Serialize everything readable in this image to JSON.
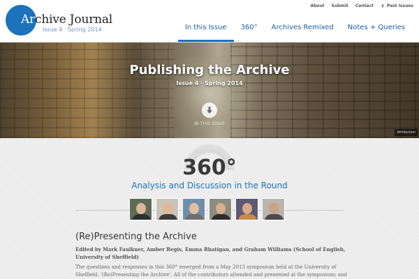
{
  "site": {
    "title_prefix": "Ar",
    "title_rest": "chive Journal",
    "issue": "Issue 4 · Spring 2014",
    "brand_color": "#1a73bb"
  },
  "util_nav": {
    "about": "About",
    "submit": "Submit",
    "contact": "Contact",
    "past_issues": "Past Issues",
    "past_icon": "pin-icon"
  },
  "main_nav": [
    {
      "label": "In this Issue",
      "active": true
    },
    {
      "label": "360°",
      "active": false
    },
    {
      "label": "Archives Remixed",
      "active": false
    },
    {
      "label": "Notes + Queries",
      "active": false
    }
  ],
  "hero": {
    "title": "Publishing the Archive",
    "subtitle": "Issue 4 · Spring 2014",
    "cta": "IN THIS ISSUE",
    "cta_icon": "arrow-down-circle-icon",
    "attribution": "Attribution"
  },
  "section": {
    "title": "360°",
    "subtitle": "Analysis and Discussion in the Round",
    "avatars": [
      "contributor-1",
      "contributor-2",
      "contributor-3",
      "contributor-4",
      "contributor-5",
      "contributor-6"
    ]
  },
  "article": {
    "title": "(Re)Presenting the Archive",
    "meta": "Edited by Mark Faulkner, Amber Regis, Emma Rhatigan, and Graham Williams (School of English, University of Sheffield)",
    "body": "The questions and responses in this 360° emerged from a May 2013 symposium held at the University of Sheffield, '(Re)Presenting the Archive'. All of the contributors attended and presented at the symposium; and their comments"
  }
}
